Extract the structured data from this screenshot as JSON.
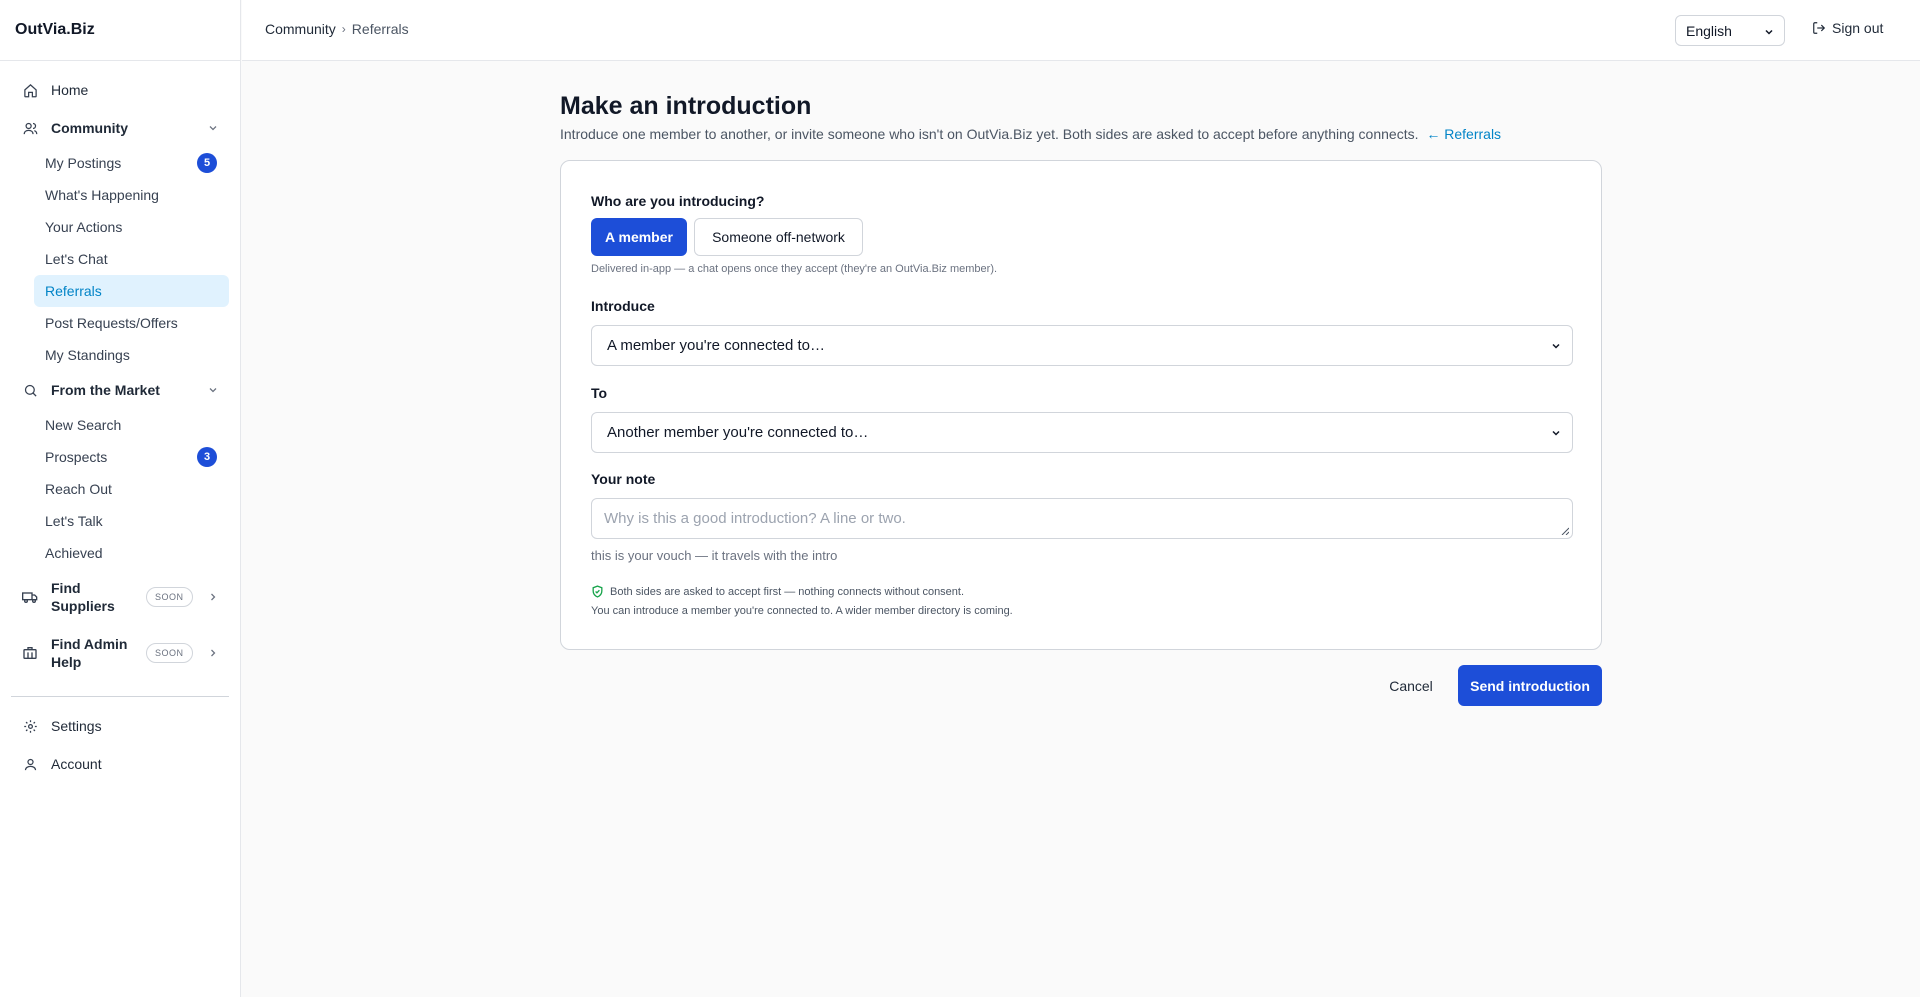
{
  "app": {
    "brand": "OutVia.Biz"
  },
  "sidebar": {
    "home": "Home",
    "community": {
      "label": "Community",
      "items": [
        {
          "label": "My Postings",
          "badge": "5"
        },
        {
          "label": "What's Happening"
        },
        {
          "label": "Your Actions"
        },
        {
          "label": "Let's Chat"
        },
        {
          "label": "Referrals",
          "active": true
        },
        {
          "label": "Post Requests/Offers"
        },
        {
          "label": "My Standings"
        }
      ]
    },
    "market": {
      "label": "From the Market",
      "items": [
        {
          "label": "New Search"
        },
        {
          "label": "Prospects",
          "badge": "3"
        },
        {
          "label": "Reach Out"
        },
        {
          "label": "Let's Talk"
        },
        {
          "label": "Achieved"
        }
      ]
    },
    "find_suppliers": {
      "label": "Find Suppliers",
      "pill": "SOON"
    },
    "find_admin": {
      "label": "Find Admin Help",
      "pill": "SOON"
    },
    "settings": "Settings",
    "account": "Account"
  },
  "header": {
    "breadcrumb": [
      "Community",
      "Referrals"
    ],
    "language": "English",
    "signout": "Sign out"
  },
  "main": {
    "title": "Make an introduction",
    "subtitle": "Introduce one member to another, or invite someone who isn't on OutVia.Biz yet. Both sides are asked to accept before anything connects.",
    "back_link": "← Referrals",
    "form": {
      "question": "Who are you introducing?",
      "option_member": "A member",
      "option_off_network": "Someone off-network",
      "hint": "Delivered in-app — a chat opens once they accept (they're an OutVia.Biz member).",
      "introduce_label": "Introduce",
      "introduce_value": "A member you're connected to…",
      "to_label": "To",
      "to_value": "Another member you're connected to…",
      "note_label": "Your note",
      "note_placeholder": "Why is this a good introduction? A line or two.",
      "note_helper": "this is your vouch — it travels with the intro",
      "consent_line": "Both sides are asked to accept first — nothing connects without consent.",
      "directory_line": "You can introduce a member you're connected to. A wider member directory is coming."
    },
    "cancel": "Cancel",
    "send": "Send introduction"
  },
  "colors": {
    "accent": "#1d4ed8",
    "link": "#0284c7",
    "active_bg": "#e0f2fe",
    "consent_icon": "#16a34a"
  }
}
